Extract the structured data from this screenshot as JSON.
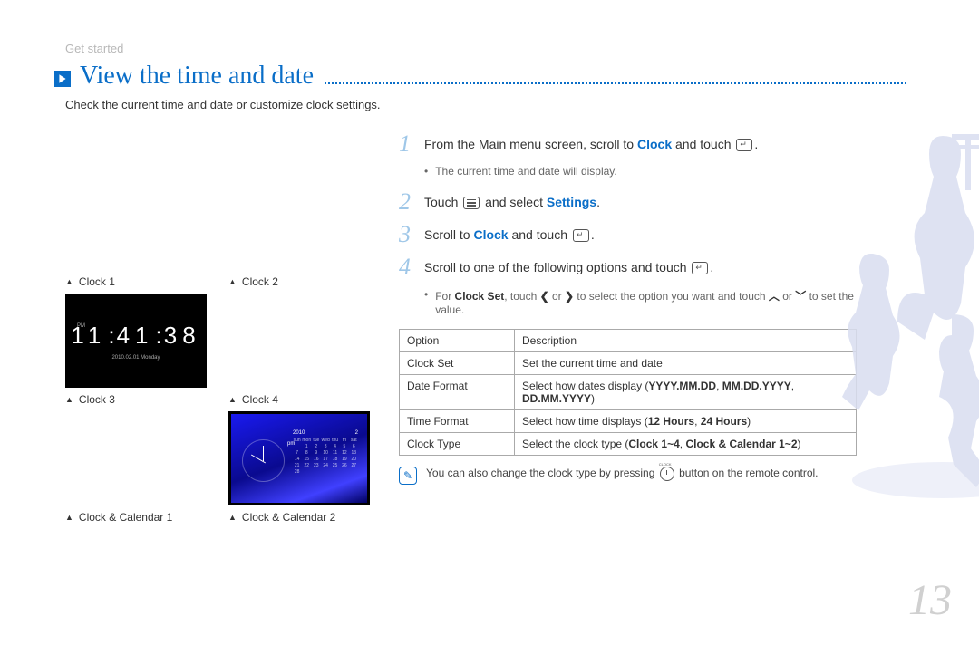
{
  "breadcrumb": "Get started",
  "title": "View the time and date",
  "intro": "Check the current time and date or customize clock settings.",
  "thumbs": {
    "c1": "Clock 1",
    "c2": "Clock 2",
    "c3": "Clock 3",
    "c4": "Clock 4",
    "cc1": "Clock & Calendar 1",
    "cc2": "Clock & Calendar 2"
  },
  "clock_sample": {
    "pm": "PM",
    "time": "11:41:38",
    "date": "2010.02.01 Monday"
  },
  "steps": {
    "s1a": "From the Main menu screen, scroll to ",
    "s1b": "Clock",
    "s1c": " and touch ",
    "s1_bullet": "The current time and date will display.",
    "s2a": "Touch ",
    "s2b": " and select ",
    "s2c": "Settings",
    "s3a": "Scroll to ",
    "s3b": "Clock",
    "s3c": " and touch ",
    "s4a": "Scroll to one of the following options and touch ",
    "s4_bullet_a": "For ",
    "s4_bullet_b": "Clock Set",
    "s4_bullet_c": ", touch ",
    "s4_bullet_d": " or ",
    "s4_bullet_e": " to select the option you want and touch ",
    "s4_bullet_f": " or ",
    "s4_bullet_g": " to set the value."
  },
  "table": {
    "h1": "Option",
    "h2": "Description",
    "rows": [
      {
        "opt": "Clock Set",
        "desc": "Set the current time and date"
      },
      {
        "opt": "Date Format",
        "desc_a": "Select how dates display (",
        "desc_b": "YYYY.MM.DD",
        "desc_c": ", ",
        "desc_d": "MM.DD.YYYY",
        "desc_e": ", ",
        "desc_f": "DD.MM.YYYY",
        "desc_g": ")"
      },
      {
        "opt": "Time Format",
        "desc_a": "Select how time displays (",
        "desc_b": "12 Hours",
        "desc_c": ", ",
        "desc_d": "24 Hours",
        "desc_e": ")"
      },
      {
        "opt": "Clock Type",
        "desc_a": "Select the clock type (",
        "desc_b": "Clock 1~4",
        "desc_c": ", ",
        "desc_d": "Clock & Calendar 1~2",
        "desc_e": ")"
      }
    ]
  },
  "note": "You can also change the clock type by pressing",
  "note2": "button on the remote control.",
  "page_number": "13",
  "cal_hdr_year": "2010",
  "cal_hdr_month": "2"
}
